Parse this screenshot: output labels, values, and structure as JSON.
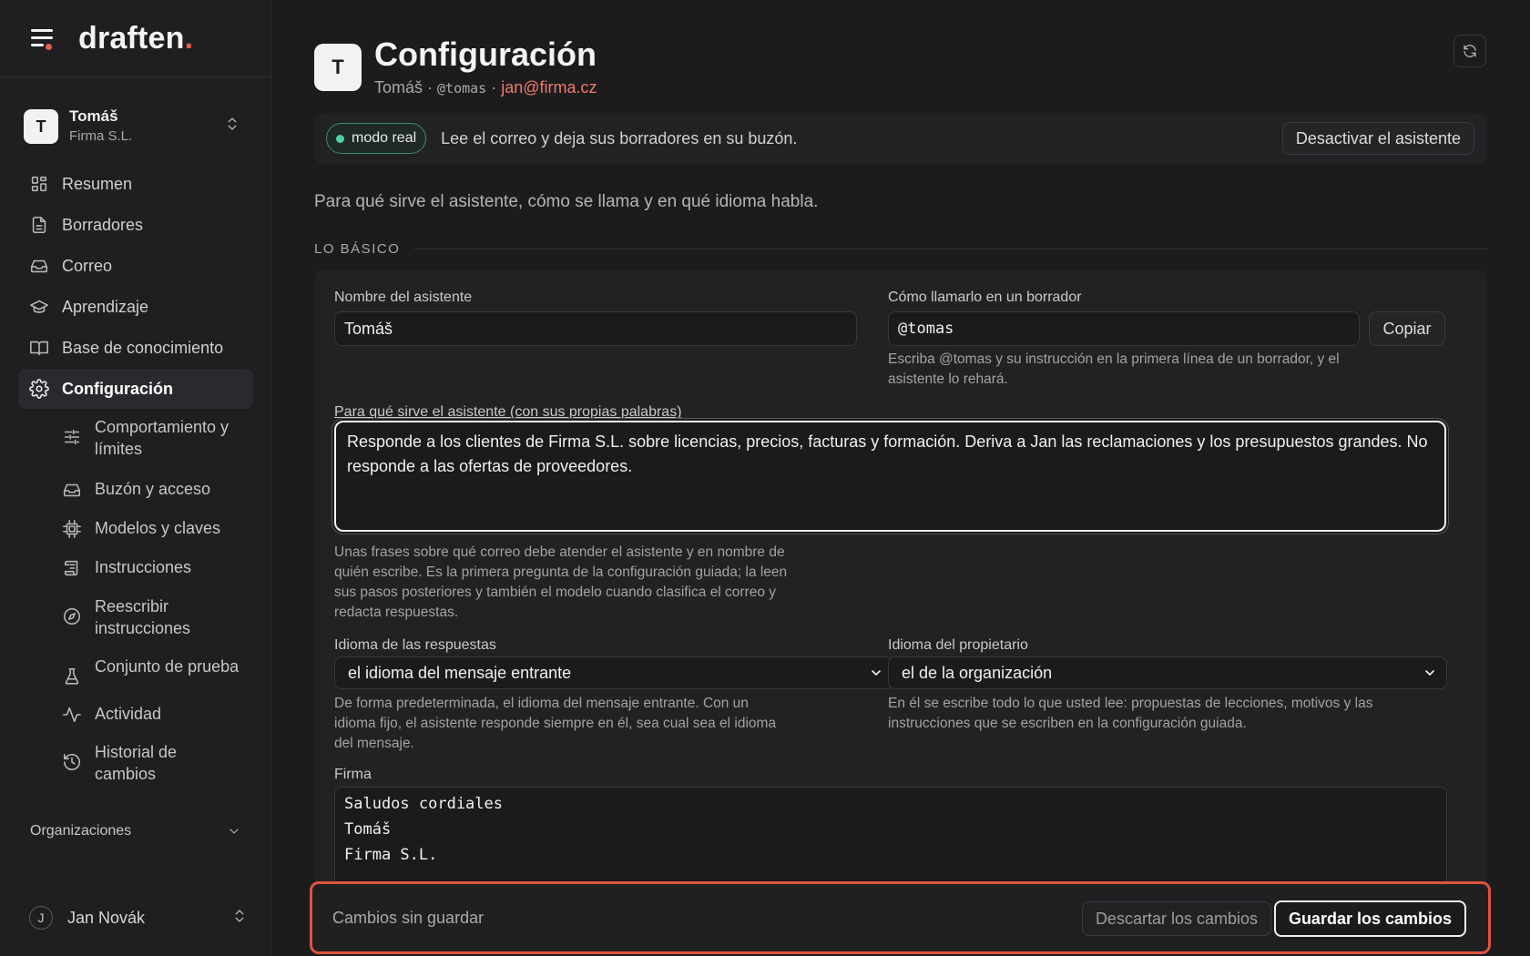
{
  "brand": {
    "name": "draften",
    "period": "."
  },
  "account": {
    "initial": "T",
    "name": "Tomáš",
    "org": "Firma S.L."
  },
  "nav": [
    {
      "label": "Resumen",
      "icon": "grid-icon"
    },
    {
      "label": "Borradores",
      "icon": "file-icon"
    },
    {
      "label": "Correo",
      "icon": "inbox-icon"
    },
    {
      "label": "Aprendizaje",
      "icon": "graduation-cap-icon"
    },
    {
      "label": "Base de conocimiento",
      "icon": "book-icon"
    },
    {
      "label": "Configuración",
      "icon": "gear-icon",
      "active": true
    }
  ],
  "subnav": [
    {
      "label": "Comportamiento y límites",
      "icon": "sliders-icon"
    },
    {
      "label": "Buzón y acceso",
      "icon": "inbox-icon"
    },
    {
      "label": "Modelos y claves",
      "icon": "cpu-icon"
    },
    {
      "label": "Instrucciones",
      "icon": "scroll-icon"
    },
    {
      "label": "Reescribir instrucciones",
      "icon": "compass-icon"
    },
    {
      "label": "Conjunto de prueba",
      "icon": "flask-icon"
    },
    {
      "label": "Actividad",
      "icon": "activity-icon"
    },
    {
      "label": "Historial de cambios",
      "icon": "history-icon"
    }
  ],
  "organizations": {
    "label": "Organizaciones"
  },
  "user": {
    "initial": "J",
    "name": "Jan Novák"
  },
  "header": {
    "initial": "T",
    "title": "Configuración",
    "name": "Tomáš",
    "separator": " · ",
    "handle": "@tomas",
    "email": "jan@firma.cz"
  },
  "mode": {
    "badge": "modo real",
    "description": "Lee el correo y deja sus borradores en su buzón.",
    "deactivate": "Desactivar el asistente"
  },
  "intro": "Para qué sirve el asistente, cómo se llama y en qué idioma habla.",
  "section_title": "LO BÁSICO",
  "form": {
    "name_label": "Nombre del asistente",
    "name_value": "Tomáš",
    "mention_label": "Cómo llamarlo en un borrador",
    "mention_value": "@tomas",
    "copy_button": "Copiar",
    "mention_help": "Escriba @tomas y su instrucción en la primera línea de un borrador, y el asistente lo rehará.",
    "purpose_label": "Para qué sirve el asistente (con sus propias palabras)",
    "purpose_value": "Responde a los clientes de Firma S.L. sobre licencias, precios, facturas y formación. Deriva a Jan las reclamaciones y los presupuestos grandes. No responde a las ofertas de proveedores.",
    "purpose_help": "Unas frases sobre qué correo debe atender el asistente y en nombre de quién escribe. Es la primera pregunta de la configuración guiada; la leen sus pasos posteriores y también el modelo cuando clasifica el correo y redacta respuestas.",
    "reply_lang_label": "Idioma de las respuestas",
    "reply_lang_value": "el idioma del mensaje entrante",
    "reply_lang_help": "De forma predeterminada, el idioma del mensaje entrante. Con un idioma fijo, el asistente responde siempre en él, sea cual sea el idioma del mensaje.",
    "owner_lang_label": "Idioma del propietario",
    "owner_lang_value": "el de la organización",
    "owner_lang_help": "En él se escribe todo lo que usted lee: propuestas de lecciones, motivos y las instrucciones que se escriben en la configuración guiada.",
    "signature_label": "Firma",
    "signature_lines": [
      "Saludos cordiales",
      "Tomáš",
      "Firma S.L."
    ]
  },
  "savebar": {
    "status": "Cambios sin guardar",
    "discard": "Descartar los cambios",
    "save": "Guardar los cambios"
  },
  "colors": {
    "accent": "#e85d4a",
    "email": "#ef7b66",
    "live": "#4fd1a0",
    "savebar_border": "#e0543e"
  }
}
